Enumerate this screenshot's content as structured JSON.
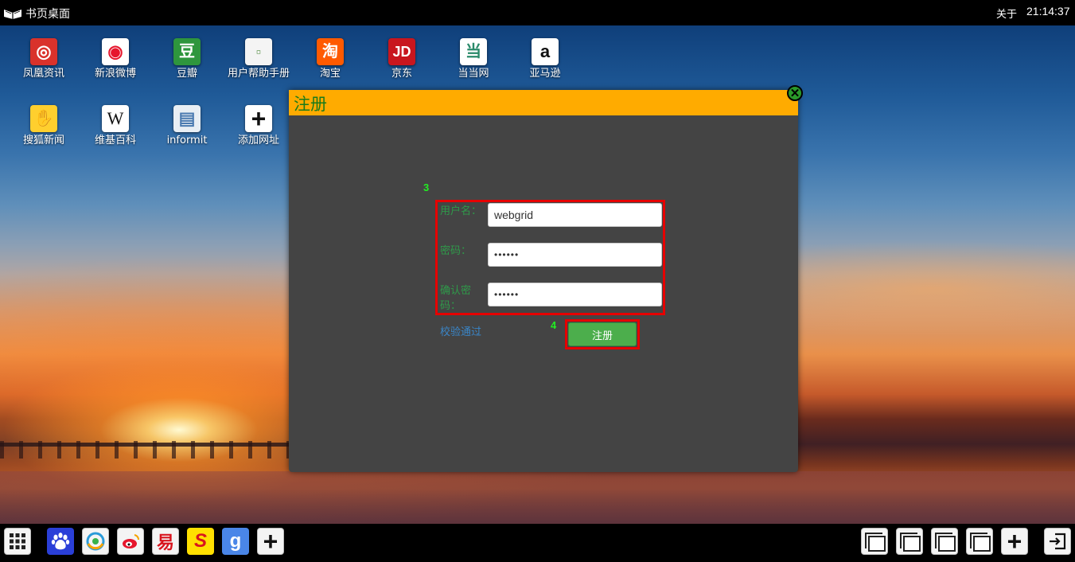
{
  "topbar": {
    "title": "书页桌面",
    "about": "关于",
    "time": "21:14:37"
  },
  "desktop_icons": [
    {
      "label": "凤凰资讯",
      "icon": "ifeng-icon",
      "glyph": "◎",
      "bg": "#d9322b",
      "fg": "#ffffff"
    },
    {
      "label": "新浪微博",
      "icon": "weibo-icon",
      "glyph": "◉",
      "bg": "#ffffff",
      "fg": "#e6162d"
    },
    {
      "label": "豆瓣",
      "icon": "douban-icon",
      "glyph": "豆",
      "bg": "#2e963d",
      "fg": "#ffffff"
    },
    {
      "label": "用户帮助手册",
      "icon": "broken-image-icon",
      "glyph": "▫",
      "bg": "#f4f4f4",
      "fg": "#6a9a5a"
    },
    {
      "label": "淘宝",
      "icon": "taobao-icon",
      "glyph": "淘",
      "bg": "#ff5a00",
      "fg": "#ffffff"
    },
    {
      "label": "京东",
      "icon": "jd-icon",
      "glyph": "JD",
      "bg": "#c8161e",
      "fg": "#ffffff"
    },
    {
      "label": "当当网",
      "icon": "dangdang-icon",
      "glyph": "当",
      "bg": "#ffffff",
      "fg": "#2a8a6a"
    },
    {
      "label": "亚马逊",
      "icon": "amazon-icon",
      "glyph": "a",
      "bg": "#ffffff",
      "fg": "#111111"
    },
    {
      "label": "搜狐新闻",
      "icon": "sohu-icon",
      "glyph": "✋",
      "bg": "#ffcf2e",
      "fg": "#ffffff"
    },
    {
      "label": "维基百科",
      "icon": "wikipedia-icon",
      "glyph": "W",
      "bg": "#ffffff",
      "fg": "#111111"
    },
    {
      "label": "informit",
      "icon": "informit-icon",
      "glyph": "▤",
      "bg": "#e8eef4",
      "fg": "#4a7ab0"
    },
    {
      "label": "添加网址",
      "icon": "plus-icon",
      "glyph": "+",
      "bg": "#ffffff",
      "fg": "#111111"
    }
  ],
  "dialog": {
    "title": "注册",
    "close_glyph": "✕",
    "marker_form": "3",
    "marker_button": "4",
    "username_label": "用户名：",
    "username_value": "webgrid",
    "password_label": "密码：",
    "password_value": "••••••",
    "confirm_label": "确认密码：",
    "confirm_value": "••••••",
    "verify_text": "校验通过",
    "register_button": "注册"
  },
  "taskbar": {
    "left": [
      {
        "icon": "app-grid-icon",
        "glyph": "⋮⋮⋮",
        "bg": "#f4f4f4",
        "fg": "#222"
      },
      {
        "icon": "baidu-icon",
        "glyph": "🐾",
        "bg": "#2a3fd8",
        "fg": "#ffffff"
      },
      {
        "icon": "qq-browser-icon",
        "glyph": "◐",
        "bg": "#f4f4f4",
        "fg": "#2a9ad8"
      },
      {
        "icon": "weibo-icon",
        "glyph": "◉",
        "bg": "#ffffff",
        "fg": "#e6162d"
      },
      {
        "icon": "yi-icon",
        "glyph": "易",
        "bg": "#ffffff",
        "fg": "#d8141e"
      },
      {
        "icon": "sohu-s-icon",
        "glyph": "S",
        "bg": "#ffe000",
        "fg": "#d8141e"
      },
      {
        "icon": "google-icon",
        "glyph": "g",
        "bg": "#4a86e8",
        "fg": "#ffffff"
      },
      {
        "icon": "plus-icon",
        "glyph": "+",
        "bg": "#ffffff",
        "fg": "#111111"
      }
    ],
    "right": [
      {
        "icon": "window-icon"
      },
      {
        "icon": "window-icon"
      },
      {
        "icon": "window-icon"
      },
      {
        "icon": "window-icon"
      },
      {
        "icon": "plus-icon",
        "glyph": "+"
      },
      {
        "icon": "exit-icon",
        "glyph": "⇥"
      }
    ]
  }
}
